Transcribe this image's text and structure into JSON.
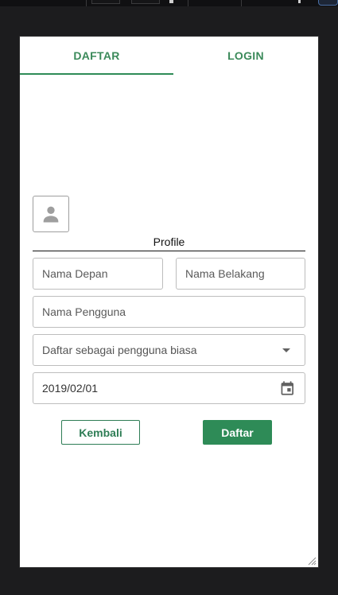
{
  "tabs": [
    {
      "label": "DAFTAR",
      "active": true
    },
    {
      "label": "LOGIN",
      "active": false
    }
  ],
  "profile": {
    "avatar_icon": "person-icon",
    "label": "Profile"
  },
  "form": {
    "first_name": {
      "placeholder": "Nama Depan",
      "value": ""
    },
    "last_name": {
      "placeholder": "Nama Belakang",
      "value": ""
    },
    "username": {
      "placeholder": "Nama Pengguna",
      "value": ""
    },
    "account_type": {
      "selected": "Daftar sebagai pengguna biasa",
      "icon": "chevron-down-icon"
    },
    "birth_date": {
      "value": "2019/02/01",
      "icon": "calendar-icon"
    }
  },
  "actions": {
    "back_label": "Kembali",
    "submit_label": "Daftar"
  },
  "colors": {
    "accent": "#2e8b57",
    "background": "#1c1c1e",
    "surface": "#ffffff"
  }
}
